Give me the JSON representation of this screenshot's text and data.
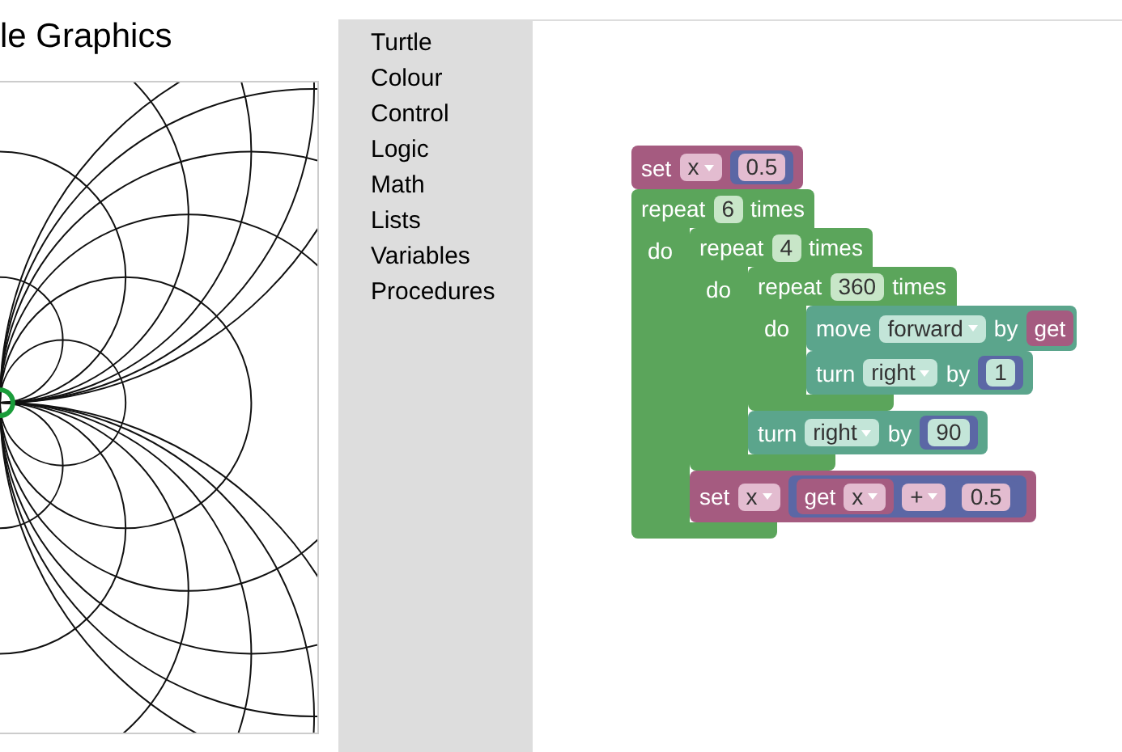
{
  "title": "le Graphics",
  "toolbox": [
    "Turtle",
    "Colour",
    "Control",
    "Logic",
    "Math",
    "Lists",
    "Variables",
    "Procedures"
  ],
  "blocks": [
    {
      "kind": "set",
      "label": "set",
      "variable": "x",
      "value": {
        "kind": "number",
        "text": "0.5"
      }
    },
    {
      "kind": "repeat",
      "label": "repeat",
      "count": "6",
      "suffix": "times",
      "do_label": "do",
      "children": [
        {
          "kind": "repeat",
          "label": "repeat",
          "count": "4",
          "suffix": "times",
          "do_label": "do",
          "children": [
            {
              "kind": "repeat",
              "label": "repeat",
              "count": "360",
              "suffix": "times",
              "do_label": "do",
              "children": [
                {
                  "kind": "move",
                  "label": "move",
                  "direction": "forward",
                  "by_label": "by",
                  "value": {
                    "kind": "get",
                    "label": "get"
                  }
                },
                {
                  "kind": "turn",
                  "label": "turn",
                  "direction": "right",
                  "by_label": "by",
                  "value": {
                    "kind": "number",
                    "text": "1"
                  }
                }
              ]
            },
            {
              "kind": "turn",
              "label": "turn",
              "direction": "right",
              "by_label": "by",
              "value": {
                "kind": "number",
                "text": "90"
              }
            }
          ]
        },
        {
          "kind": "set",
          "label": "set",
          "variable": "x",
          "value": {
            "kind": "arithmetic",
            "left": {
              "kind": "get",
              "label": "get",
              "variable": "x"
            },
            "operator": "+",
            "right": {
              "kind": "number",
              "text": "0.5"
            }
          }
        }
      ]
    }
  ]
}
